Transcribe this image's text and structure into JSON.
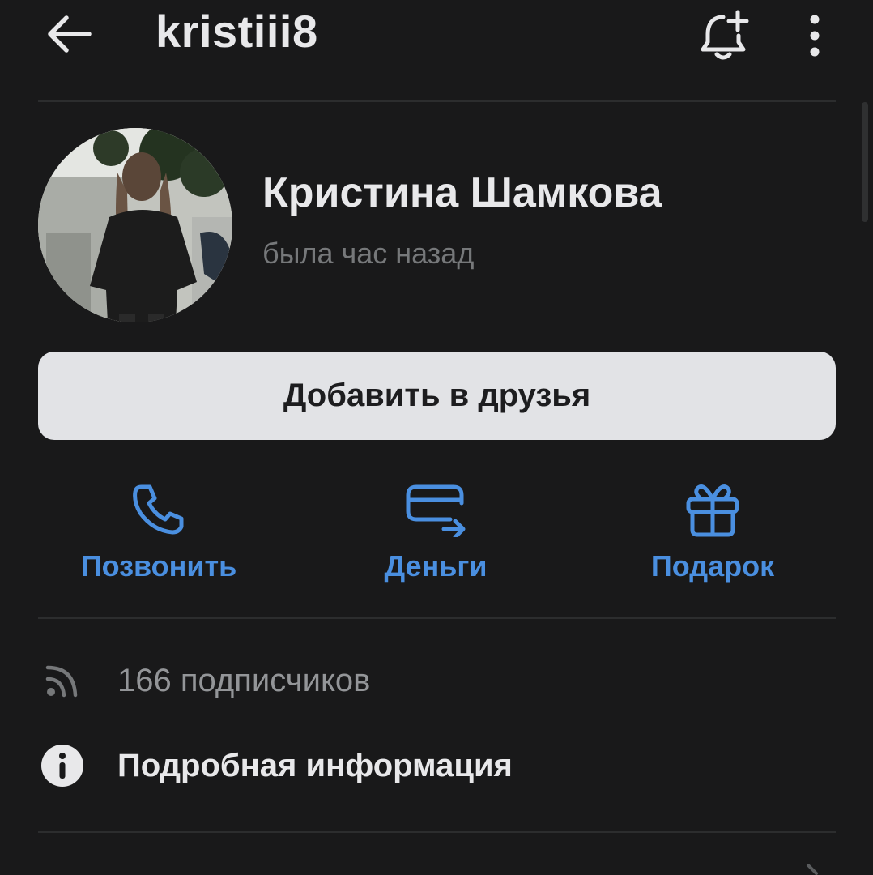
{
  "topbar": {
    "username": "kristiii8",
    "back_icon": "arrow-left-icon",
    "bell_icon": "bell-plus-icon",
    "more_icon": "more-vertical-icon"
  },
  "profile": {
    "full_name": "Кристина Шамкова",
    "last_seen": "была час назад",
    "add_friend_label": "Добавить в друзья"
  },
  "actions": [
    {
      "label": "Позвонить",
      "icon": "phone-icon"
    },
    {
      "label": "Деньги",
      "icon": "money-transfer-icon"
    },
    {
      "label": "Подарок",
      "icon": "gift-icon"
    }
  ],
  "info": {
    "subscribers": "166 подписчиков",
    "subscribers_icon": "rss-icon",
    "details": "Подробная информация",
    "details_icon": "info-icon"
  },
  "colors": {
    "background": "#19191a",
    "accent": "#4a8fe0",
    "button_bg": "#e2e3e6",
    "secondary_text": "#76787a"
  }
}
